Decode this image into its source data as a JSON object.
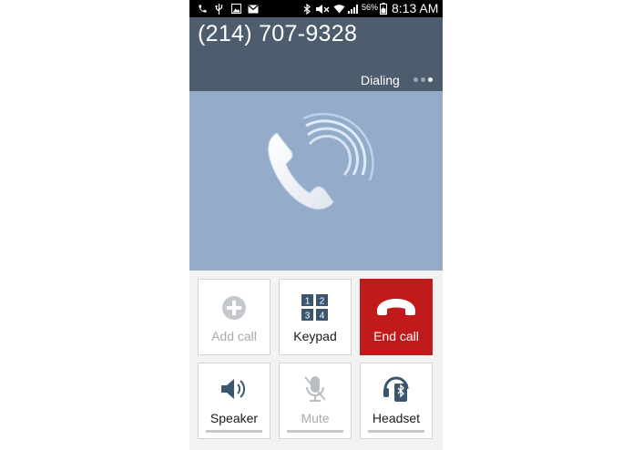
{
  "status_bar": {
    "battery_percent": "56%",
    "time": "8:13 AM",
    "icons": [
      "phone-icon",
      "usb-icon",
      "image-icon",
      "email-icon",
      "bluetooth-icon",
      "mute-icon",
      "wifi-icon",
      "signal-icon",
      "battery-icon"
    ]
  },
  "call": {
    "number": "(214) 707-9328",
    "status": "Dialing",
    "page_dots": 3,
    "active_dot": 3
  },
  "buttons": {
    "add_call": "Add call",
    "keypad": "Keypad",
    "keypad_digits": [
      "1",
      "2",
      "3",
      "4"
    ],
    "end_call": "End call",
    "speaker": "Speaker",
    "mute": "Mute",
    "headset": "Headset"
  },
  "colors": {
    "header": "#4e5d6d",
    "call_area": "#94acca",
    "end_call": "#c11a1a",
    "keypad_icon": "#3c5670"
  }
}
